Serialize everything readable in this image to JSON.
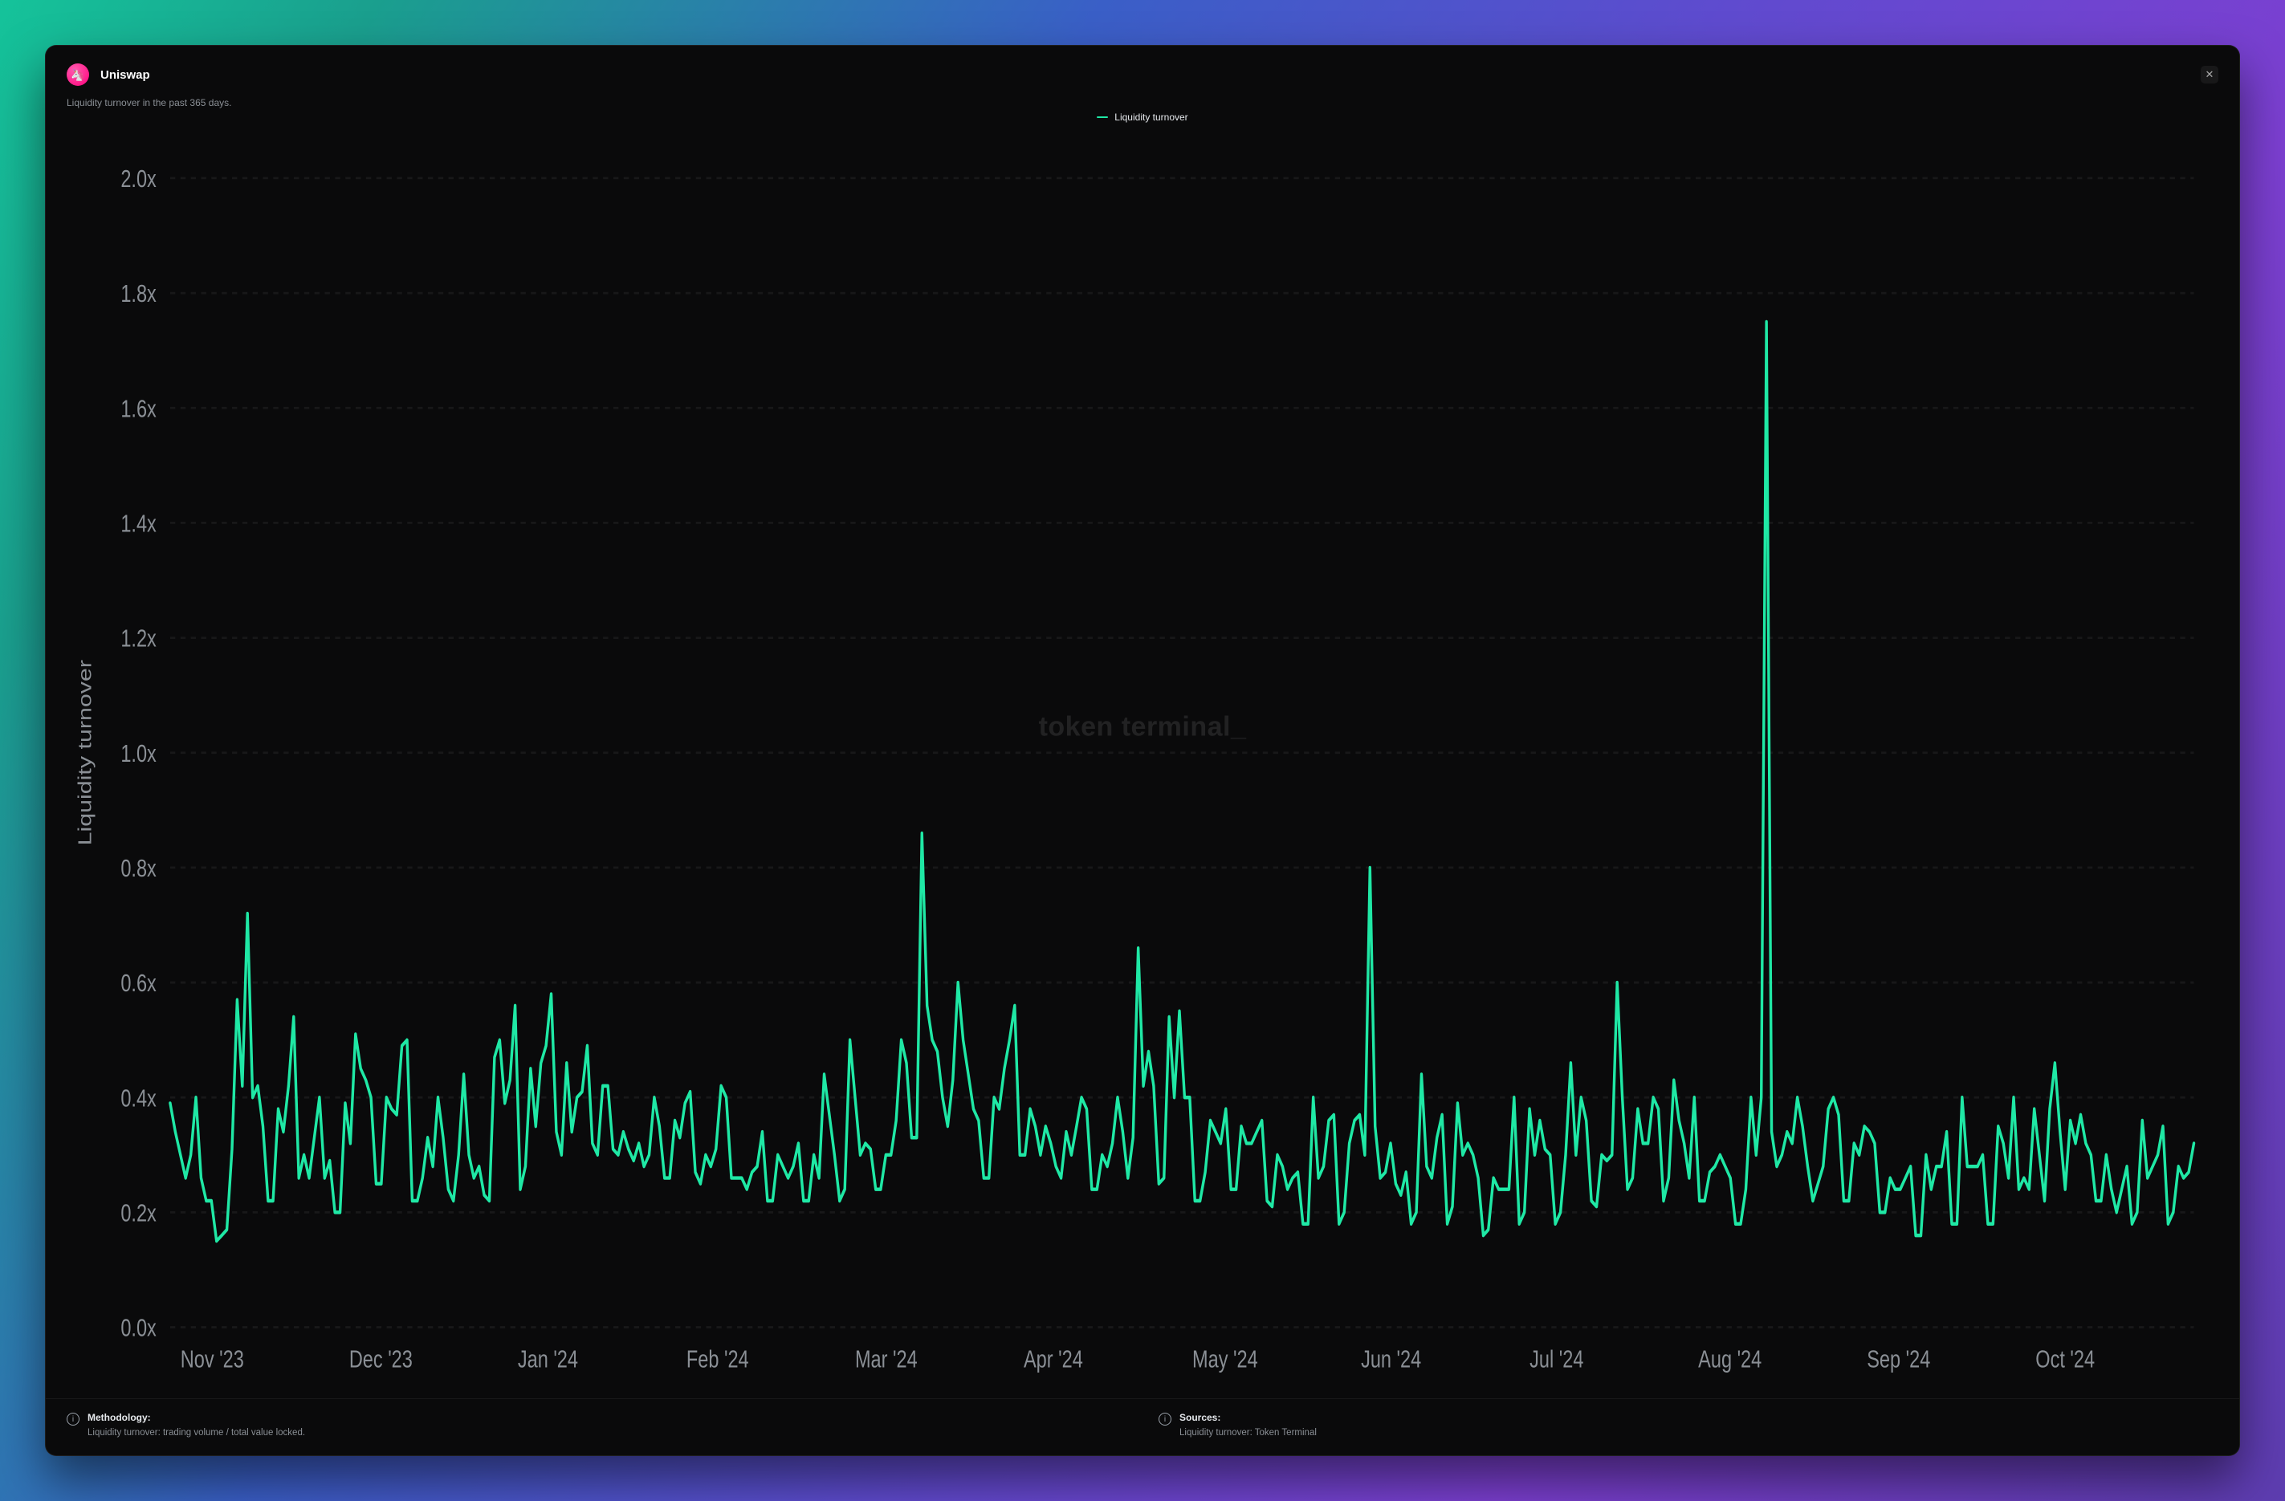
{
  "header": {
    "title": "Uniswap",
    "subtitle": "Liquidity turnover in the past 365 days."
  },
  "legend": {
    "label": "Liquidity turnover"
  },
  "watermark": "token terminal_",
  "footer": {
    "methodology_heading": "Methodology:",
    "methodology_text": "Liquidity turnover: trading volume / total value locked.",
    "sources_heading": "Sources:",
    "sources_text": "Liquidity turnover: Token Terminal"
  },
  "chart_data": {
    "type": "line",
    "title": "",
    "xlabel": "",
    "ylabel": "Liquidity turnover",
    "ylim": [
      0.0,
      2.0
    ],
    "y_ticks": [
      "0.0x",
      "0.2x",
      "0.4x",
      "0.6x",
      "0.8x",
      "1.0x",
      "1.2x",
      "1.4x",
      "1.6x",
      "1.8x",
      "2.0x"
    ],
    "x_ticks": [
      "Nov '23",
      "Dec '23",
      "Jan '24",
      "Feb '24",
      "Mar '24",
      "Apr '24",
      "May '24",
      "Jun '24",
      "Jul '24",
      "Aug '24",
      "Sep '24",
      "Oct '24"
    ],
    "series": [
      {
        "name": "Liquidity turnover",
        "color": "#1fe8a5",
        "values": [
          0.39,
          0.34,
          0.3,
          0.26,
          0.3,
          0.4,
          0.26,
          0.22,
          0.22,
          0.15,
          0.16,
          0.17,
          0.31,
          0.57,
          0.42,
          0.72,
          0.4,
          0.42,
          0.35,
          0.22,
          0.22,
          0.38,
          0.34,
          0.42,
          0.54,
          0.26,
          0.3,
          0.26,
          0.33,
          0.4,
          0.26,
          0.29,
          0.2,
          0.2,
          0.39,
          0.32,
          0.51,
          0.45,
          0.43,
          0.4,
          0.25,
          0.25,
          0.4,
          0.38,
          0.37,
          0.49,
          0.5,
          0.22,
          0.22,
          0.26,
          0.33,
          0.28,
          0.4,
          0.33,
          0.24,
          0.22,
          0.3,
          0.44,
          0.3,
          0.26,
          0.28,
          0.23,
          0.22,
          0.47,
          0.5,
          0.39,
          0.43,
          0.56,
          0.24,
          0.28,
          0.45,
          0.35,
          0.46,
          0.49,
          0.58,
          0.34,
          0.3,
          0.46,
          0.34,
          0.4,
          0.41,
          0.49,
          0.32,
          0.3,
          0.42,
          0.42,
          0.31,
          0.3,
          0.34,
          0.31,
          0.29,
          0.32,
          0.28,
          0.3,
          0.4,
          0.35,
          0.26,
          0.26,
          0.36,
          0.33,
          0.39,
          0.41,
          0.27,
          0.25,
          0.3,
          0.28,
          0.31,
          0.42,
          0.4,
          0.26,
          0.26,
          0.26,
          0.24,
          0.27,
          0.28,
          0.34,
          0.22,
          0.22,
          0.3,
          0.28,
          0.26,
          0.28,
          0.32,
          0.22,
          0.22,
          0.3,
          0.26,
          0.44,
          0.37,
          0.3,
          0.22,
          0.24,
          0.5,
          0.4,
          0.3,
          0.32,
          0.31,
          0.24,
          0.24,
          0.3,
          0.3,
          0.36,
          0.5,
          0.46,
          0.33,
          0.33,
          0.86,
          0.56,
          0.5,
          0.48,
          0.4,
          0.35,
          0.43,
          0.6,
          0.5,
          0.44,
          0.38,
          0.36,
          0.26,
          0.26,
          0.4,
          0.38,
          0.45,
          0.5,
          0.56,
          0.3,
          0.3,
          0.38,
          0.35,
          0.3,
          0.35,
          0.32,
          0.28,
          0.26,
          0.34,
          0.3,
          0.35,
          0.4,
          0.38,
          0.24,
          0.24,
          0.3,
          0.28,
          0.32,
          0.4,
          0.34,
          0.26,
          0.33,
          0.66,
          0.42,
          0.48,
          0.42,
          0.25,
          0.26,
          0.54,
          0.4,
          0.55,
          0.4,
          0.4,
          0.22,
          0.22,
          0.27,
          0.36,
          0.34,
          0.32,
          0.38,
          0.24,
          0.24,
          0.35,
          0.32,
          0.32,
          0.34,
          0.36,
          0.22,
          0.21,
          0.3,
          0.28,
          0.24,
          0.26,
          0.27,
          0.18,
          0.18,
          0.4,
          0.26,
          0.28,
          0.36,
          0.37,
          0.18,
          0.2,
          0.32,
          0.36,
          0.37,
          0.3,
          0.8,
          0.35,
          0.26,
          0.27,
          0.32,
          0.25,
          0.23,
          0.27,
          0.18,
          0.2,
          0.44,
          0.28,
          0.26,
          0.33,
          0.37,
          0.18,
          0.21,
          0.39,
          0.3,
          0.32,
          0.3,
          0.26,
          0.16,
          0.17,
          0.26,
          0.24,
          0.24,
          0.24,
          0.4,
          0.18,
          0.2,
          0.38,
          0.3,
          0.36,
          0.31,
          0.3,
          0.18,
          0.2,
          0.3,
          0.46,
          0.3,
          0.4,
          0.36,
          0.22,
          0.21,
          0.3,
          0.29,
          0.3,
          0.6,
          0.4,
          0.24,
          0.26,
          0.38,
          0.32,
          0.32,
          0.4,
          0.38,
          0.22,
          0.26,
          0.43,
          0.36,
          0.32,
          0.26,
          0.4,
          0.22,
          0.22,
          0.27,
          0.28,
          0.3,
          0.28,
          0.26,
          0.18,
          0.18,
          0.24,
          0.4,
          0.3,
          0.4,
          1.75,
          0.34,
          0.28,
          0.3,
          0.34,
          0.32,
          0.4,
          0.35,
          0.28,
          0.22,
          0.25,
          0.28,
          0.38,
          0.4,
          0.37,
          0.22,
          0.22,
          0.32,
          0.3,
          0.35,
          0.34,
          0.32,
          0.2,
          0.2,
          0.26,
          0.24,
          0.24,
          0.26,
          0.28,
          0.16,
          0.16,
          0.3,
          0.24,
          0.28,
          0.28,
          0.34,
          0.18,
          0.18,
          0.4,
          0.28,
          0.28,
          0.28,
          0.3,
          0.18,
          0.18,
          0.35,
          0.32,
          0.26,
          0.4,
          0.24,
          0.26,
          0.24,
          0.38,
          0.3,
          0.22,
          0.38,
          0.46,
          0.34,
          0.24,
          0.36,
          0.32,
          0.37,
          0.32,
          0.3,
          0.22,
          0.22,
          0.3,
          0.24,
          0.2,
          0.24,
          0.28,
          0.18,
          0.2,
          0.36,
          0.26,
          0.28,
          0.3,
          0.35,
          0.18,
          0.2,
          0.28,
          0.26,
          0.27,
          0.32
        ]
      }
    ]
  }
}
